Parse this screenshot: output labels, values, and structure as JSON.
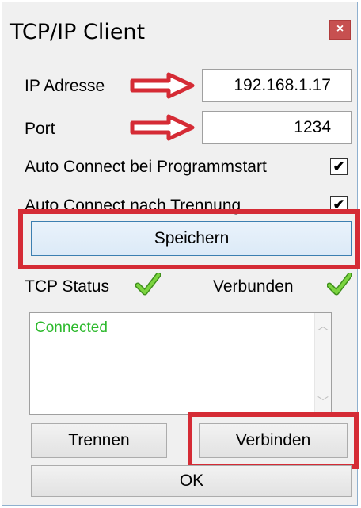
{
  "window": {
    "title": "TCP/IP Client",
    "close_label": "×"
  },
  "form": {
    "ip_label": "IP Adresse",
    "ip_value": "192.168.1.17",
    "port_label": "Port",
    "port_value": "1234",
    "auto_connect_start_label": "Auto Connect bei Programmstart",
    "auto_connect_start_checked": true,
    "auto_connect_disconnect_label": "Auto Connect nach Trennung",
    "auto_connect_disconnect_checked": true,
    "save_label": "Speichern"
  },
  "status": {
    "tcp_label": "TCP Status",
    "connection_label": "Verbunden"
  },
  "log": {
    "text": "Connected"
  },
  "buttons": {
    "disconnect_label": "Trennen",
    "connect_label": "Verbinden",
    "ok_label": "OK"
  },
  "colors": {
    "highlight": "#d52b35",
    "arrow": "#d52b35",
    "check": "#5cb82a",
    "log_text": "#2db92d"
  },
  "icons": {
    "check": "check-icon",
    "arrow": "arrow-right-icon"
  }
}
